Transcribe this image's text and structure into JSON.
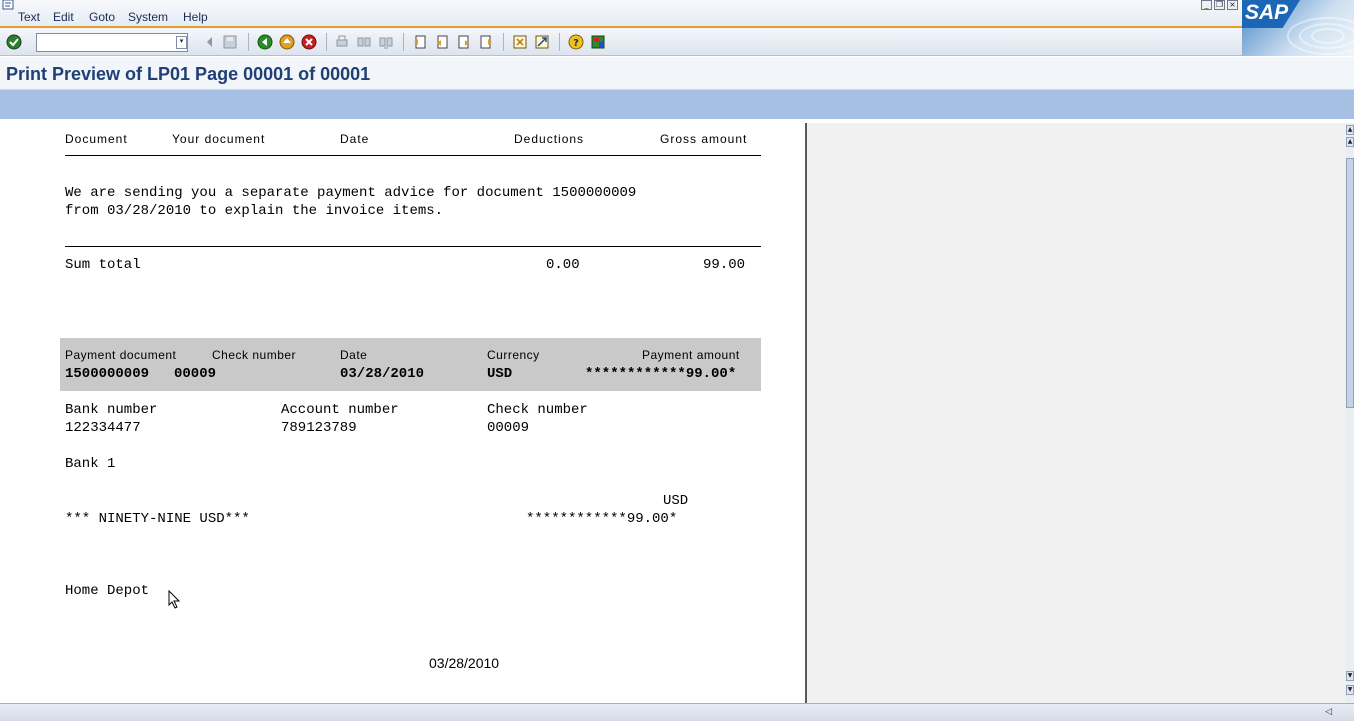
{
  "menu": {
    "items": [
      "Text",
      "Edit",
      "Goto",
      "System",
      "Help"
    ]
  },
  "brand": {
    "logo_text": "SAP"
  },
  "toolbar": {
    "command_value": "",
    "icons": [
      "enter-icon",
      "back-icon",
      "exit-icon",
      "cancel-icon",
      "print-icon",
      "find-icon",
      "find-next-icon",
      "first-page-icon",
      "prev-page-icon",
      "next-page-icon",
      "last-page-icon",
      "new-session-icon",
      "shortcut-icon",
      "help-icon",
      "layout-icon"
    ]
  },
  "title": "Print Preview of LP01 Page 00001 of 00001",
  "document": {
    "columns": {
      "document": "Document",
      "your_document": "Your document",
      "date": "Date",
      "deductions": "Deductions",
      "gross_amount": "Gross amount"
    },
    "advice_line1": "We are sending you a separate payment advice for document 1500000009",
    "advice_line2": "from 03/28/2010 to explain the invoice items.",
    "sum_label": "Sum total",
    "sum_deductions": "0.00",
    "sum_gross": "99.00",
    "payment": {
      "doc_label": "Payment document",
      "check_label": "Check number",
      "date_label": "Date",
      "currency_label": "Currency",
      "amount_label": "Payment amount",
      "doc_value": "1500000009",
      "check_value": "00009",
      "date_value": "03/28/2010",
      "currency_value": "USD",
      "amount_value": "************99.00*"
    },
    "bank": {
      "bank_number_label": "Bank number",
      "account_number_label": "Account number",
      "check_number_label": "Check number",
      "bank_number": "122334477",
      "account_number": "789123789",
      "check_number": "00009",
      "bank_name": "Bank 1"
    },
    "currency_code": "USD",
    "amount_words": "*** NINETY-NINE USD***",
    "amount_stars": "************99.00*",
    "payee": "Home Depot",
    "footer_date": "03/28/2010"
  },
  "colors": {
    "accent_orange": "#e39b2a",
    "title_blue": "#1f3f75",
    "app_toolbar": "#a5c0e2",
    "payment_box": "#c9c9c9"
  }
}
